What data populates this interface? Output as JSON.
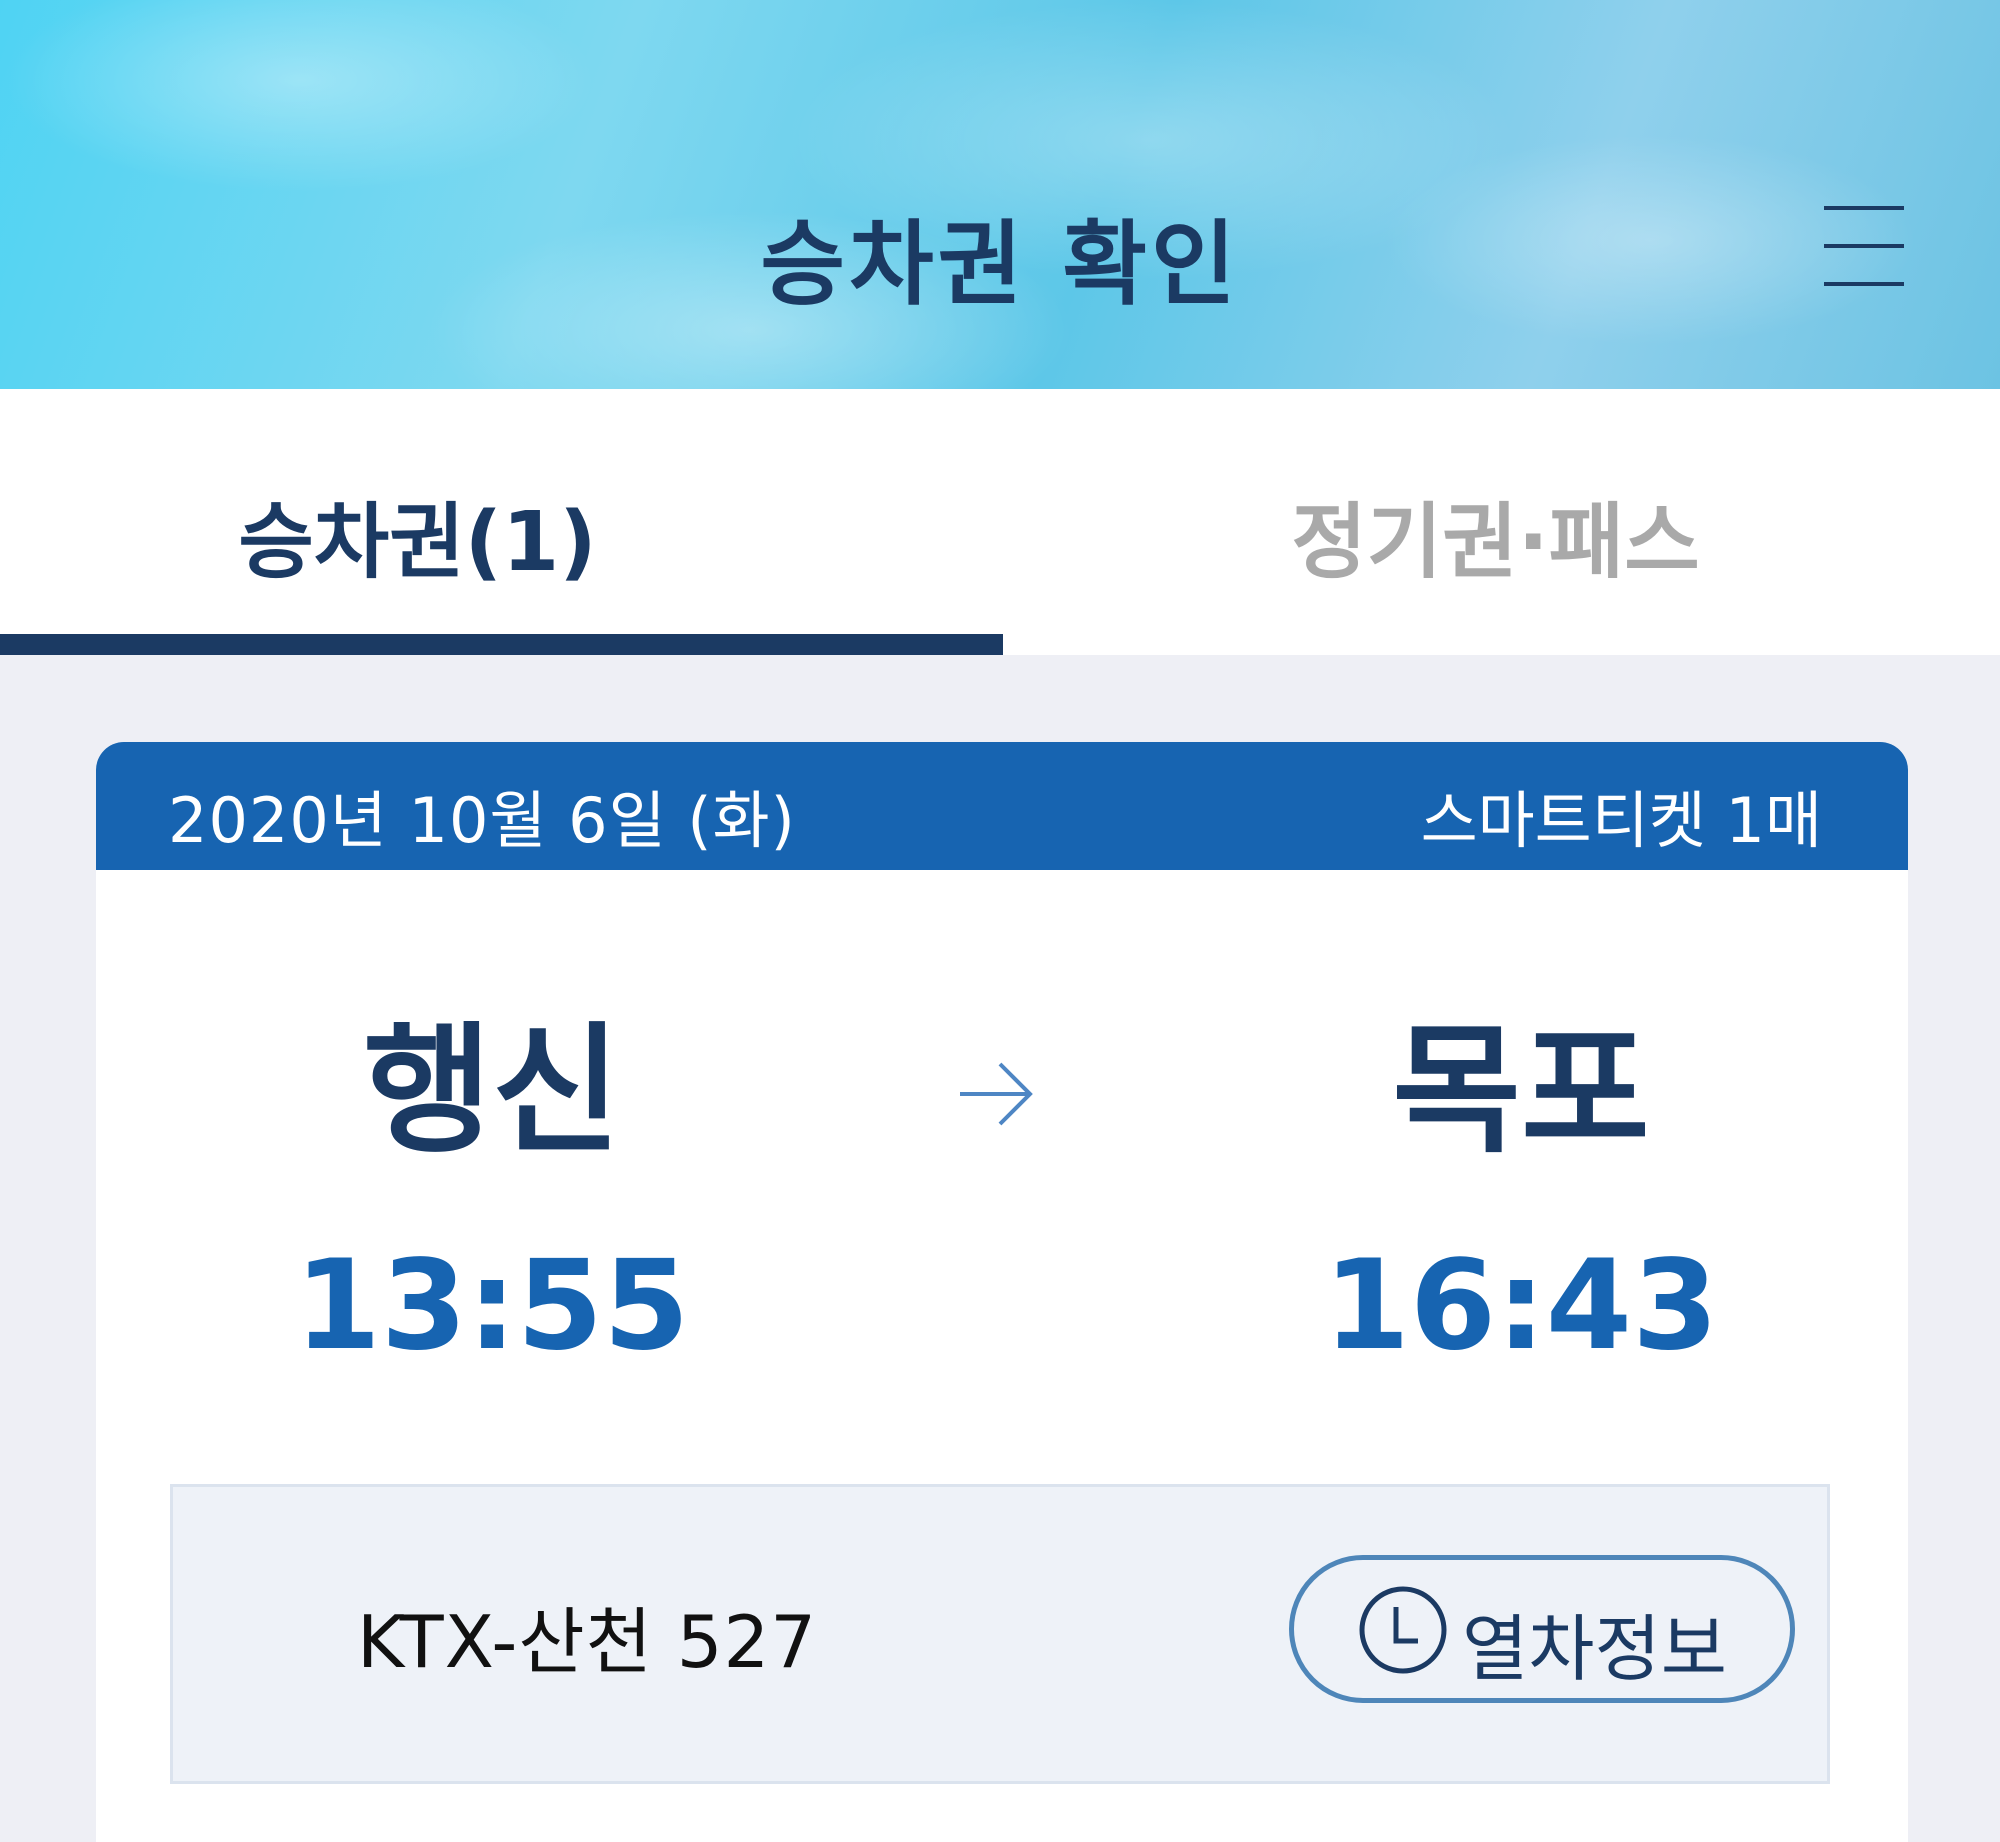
{
  "header": {
    "title": "승차권 확인",
    "menu_icon": "hamburger-menu-icon"
  },
  "tabs": [
    {
      "label": "승차권(1)",
      "active": true
    },
    {
      "label": "정기권·패스",
      "active": false
    }
  ],
  "ticket": {
    "date": "2020년 10월 6일 (화)",
    "ticket_count": "스마트티켓 1매",
    "departure": {
      "station": "행신",
      "time": "13:55"
    },
    "arrival": {
      "station": "목포",
      "time": "16:43"
    },
    "route_icon": "arrow-right-icon",
    "train_name": "KTX-산천 527",
    "train_info_button": "열차정보",
    "train_info_icon": "clock-icon"
  },
  "colors": {
    "navy": "#1b3a63",
    "blue": "#1764b1",
    "inactive_tab": "#a9a9a9",
    "background": "#eeeff5"
  }
}
